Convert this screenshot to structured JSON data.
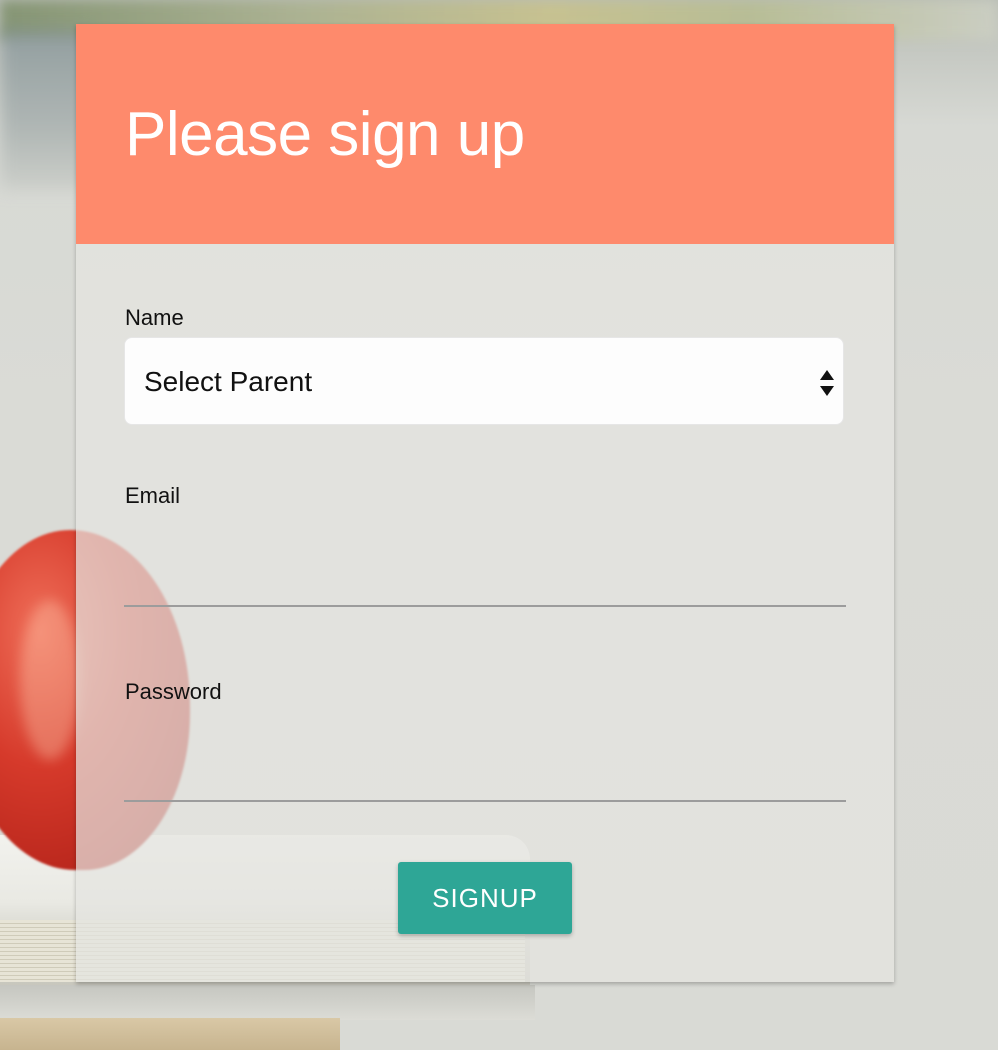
{
  "header": {
    "title": "Please sign up"
  },
  "form": {
    "name_label": "Name",
    "name_select_value": "Select Parent",
    "email_label": "Email",
    "email_value": "",
    "password_label": "Password",
    "password_value": "",
    "signup_label": "SIGNUP"
  },
  "colors": {
    "header_bg": "#fe8a6c",
    "button_bg": "#2ea696"
  }
}
